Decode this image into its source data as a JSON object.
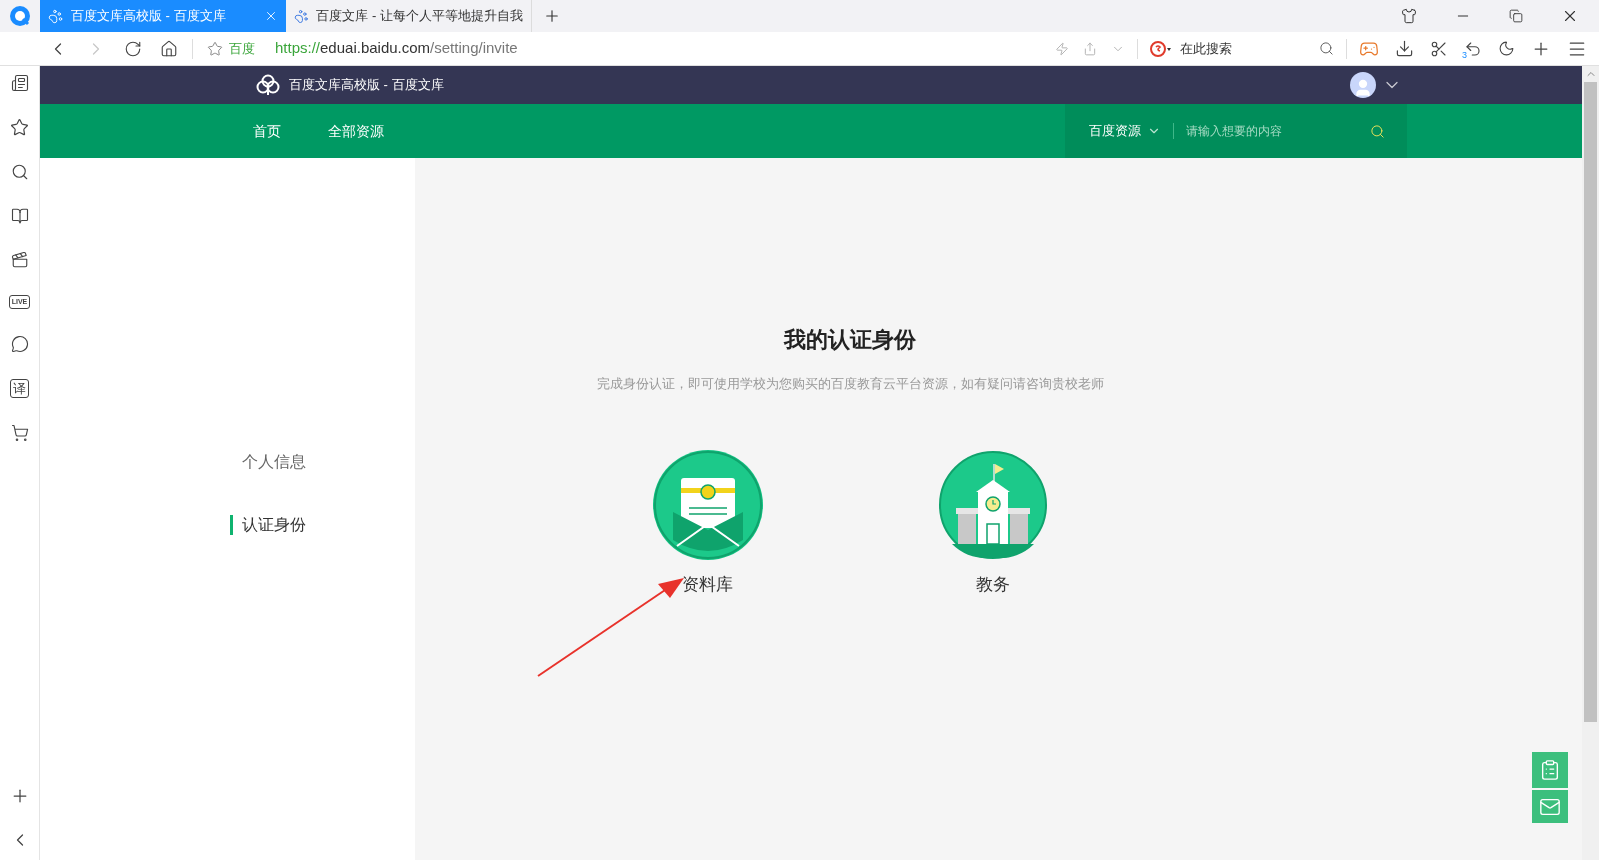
{
  "browser": {
    "tabs": [
      {
        "title": "百度文库高校版 - 百度文库",
        "selected": true
      },
      {
        "title": "百度文库 - 让每个人平等地提升自我",
        "selected": false
      }
    ],
    "bookmark_label": "百度",
    "url_scheme": "https://",
    "url_host": "eduai.baidu.com",
    "url_path": "/setting/invite",
    "search_placeholder": "在此搜索",
    "undo_count": "3",
    "sidebar_live": "LIVE",
    "sidebar_translate": "译"
  },
  "header": {
    "site_title": "百度文库高校版 - 百度文库"
  },
  "nav": {
    "items": [
      "首页",
      "全部资源"
    ],
    "search_scope": "百度资源",
    "search_placeholder": "请输入想要的内容"
  },
  "sidebar": {
    "items": [
      {
        "label": "个人信息",
        "selected": false
      },
      {
        "label": "认证身份",
        "selected": true
      }
    ]
  },
  "main": {
    "title": "我的认证身份",
    "subtitle": "完成身份认证，即可使用学校为您购买的百度教育云平台资源，如有疑问请咨询贵校老师",
    "options": [
      {
        "kind": "library",
        "label": "资料库"
      },
      {
        "kind": "school",
        "label": "教务"
      }
    ]
  }
}
